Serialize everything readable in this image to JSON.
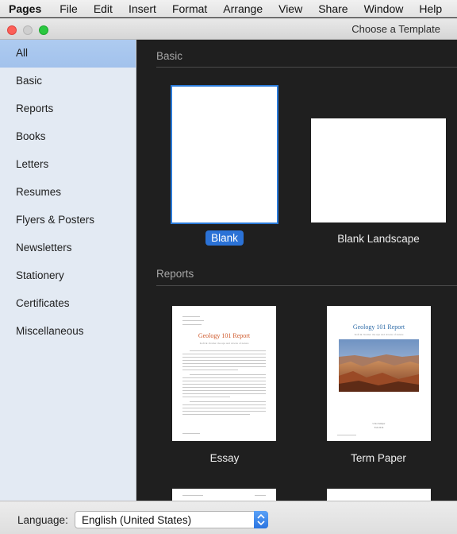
{
  "menubar": {
    "app": "Pages",
    "items": [
      "File",
      "Edit",
      "Insert",
      "Format",
      "Arrange",
      "View",
      "Share",
      "Window",
      "Help"
    ]
  },
  "window": {
    "title": "Choose a Template"
  },
  "sidebar": {
    "items": [
      {
        "label": "All",
        "selected": true
      },
      {
        "label": "Basic"
      },
      {
        "label": "Reports"
      },
      {
        "label": "Books"
      },
      {
        "label": "Letters"
      },
      {
        "label": "Resumes"
      },
      {
        "label": "Flyers & Posters"
      },
      {
        "label": "Newsletters"
      },
      {
        "label": "Stationery"
      },
      {
        "label": "Certificates"
      },
      {
        "label": "Miscellaneous"
      }
    ]
  },
  "sections": {
    "basic": {
      "header": "Basic",
      "templates": [
        {
          "label": "Blank",
          "selected": true
        },
        {
          "label": "Blank Landscape"
        }
      ]
    },
    "reports": {
      "header": "Reports",
      "templates": [
        {
          "label": "Essay",
          "doc_title": "Geology 101 Report",
          "doc_subtitle": "Kofi & Jicama: the ups and downs of nature"
        },
        {
          "label": "Term Paper",
          "doc_title": "Geology 101 Report",
          "doc_subtitle": "Kofi & Jicama: the ups and downs of nature",
          "doc_author": "Urna Semper",
          "doc_date": "Fall 2016"
        }
      ]
    }
  },
  "footer": {
    "language_label": "Language:",
    "language_value": "English (United States)"
  },
  "colors": {
    "accent": "#2b72d6",
    "sidebar_selected": "#a2c2ec",
    "content_bg": "#1f1f1f",
    "report_title_orange": "#cf5a2c",
    "report_title_blue": "#2f6ca8"
  }
}
